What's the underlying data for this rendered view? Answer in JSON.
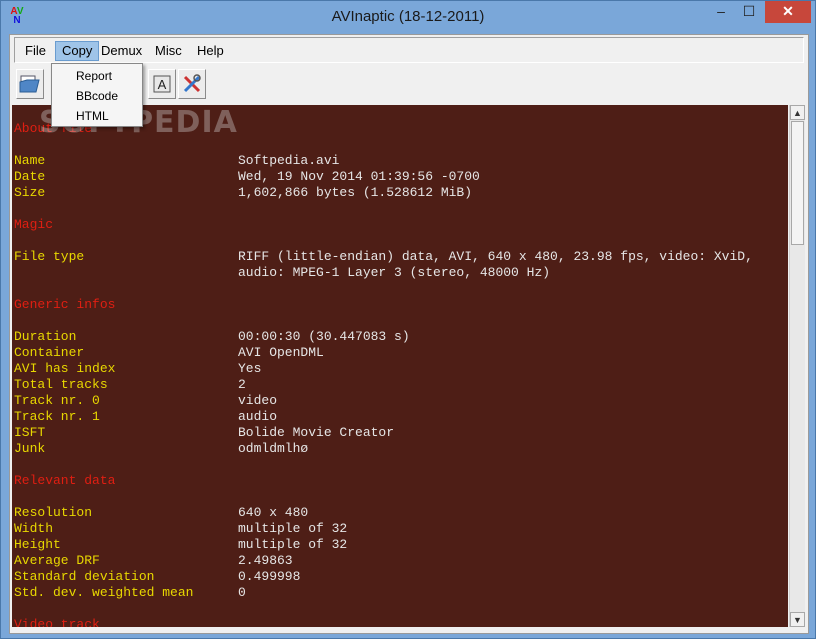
{
  "window": {
    "title": "AVInaptic (18-12-2011)",
    "minimize": "–",
    "maximize": "☐",
    "close": "✕"
  },
  "menu": {
    "items": [
      {
        "label": "File"
      },
      {
        "label": "Copy"
      },
      {
        "label": "Demux"
      },
      {
        "label": "Misc"
      },
      {
        "label": "Help"
      }
    ],
    "active": "Copy"
  },
  "copy_menu": {
    "items": [
      {
        "label": "Report"
      },
      {
        "label": "BBcode"
      },
      {
        "label": "HTML"
      }
    ]
  },
  "toolbar": {
    "buttons": [
      "open-folder-icon",
      "font-icon",
      "tools-icon"
    ]
  },
  "watermark": "SOFTPEDIA",
  "report": {
    "lines": [
      {
        "type": "section",
        "text": "About file"
      },
      {
        "type": "blank"
      },
      {
        "type": "row",
        "label": "Name",
        "value": "Softpedia.avi"
      },
      {
        "type": "row",
        "label": "Date",
        "value": "Wed, 19 Nov 2014 01:39:56 -0700"
      },
      {
        "type": "row",
        "label": "Size",
        "value": "1,602,866 bytes (1.528612 MiB)"
      },
      {
        "type": "blank"
      },
      {
        "type": "section",
        "text": "Magic"
      },
      {
        "type": "blank"
      },
      {
        "type": "row",
        "label": "File type",
        "value": "RIFF (little-endian) data, AVI, 640 x 480, 23.98 fps, video: XviD,"
      },
      {
        "type": "row",
        "label": "",
        "value": "audio: MPEG-1 Layer 3 (stereo, 48000 Hz)"
      },
      {
        "type": "blank"
      },
      {
        "type": "section",
        "text": "Generic infos"
      },
      {
        "type": "blank"
      },
      {
        "type": "row",
        "label": "Duration",
        "value": "00:00:30 (30.447083 s)"
      },
      {
        "type": "row",
        "label": "Container",
        "value": "AVI OpenDML"
      },
      {
        "type": "row",
        "label": "AVI has index",
        "value": "Yes"
      },
      {
        "type": "row",
        "label": "Total tracks",
        "value": "2"
      },
      {
        "type": "row",
        "label": "Track nr. 0",
        "value": "video"
      },
      {
        "type": "row",
        "label": "Track nr. 1",
        "value": "audio"
      },
      {
        "type": "row",
        "label": "ISFT",
        "value": "Bolide Movie Creator"
      },
      {
        "type": "row",
        "label": "Junk",
        "value": "odmldmlhø"
      },
      {
        "type": "blank"
      },
      {
        "type": "section",
        "text": "Relevant data"
      },
      {
        "type": "blank"
      },
      {
        "type": "row",
        "label": "Resolution",
        "value": "640 x 480"
      },
      {
        "type": "row",
        "label": "Width",
        "value": "multiple of 32"
      },
      {
        "type": "row",
        "label": "Height",
        "value": "multiple of 32"
      },
      {
        "type": "row",
        "label": "Average DRF",
        "value": "2.49863"
      },
      {
        "type": "row",
        "label": "Standard deviation",
        "value": "0.499998"
      },
      {
        "type": "row",
        "label": "Std. dev. weighted mean",
        "value": "0"
      },
      {
        "type": "blank"
      },
      {
        "type": "section",
        "text": "Video track"
      }
    ]
  },
  "scrollbar": {
    "up": "▲",
    "down": "▼"
  }
}
